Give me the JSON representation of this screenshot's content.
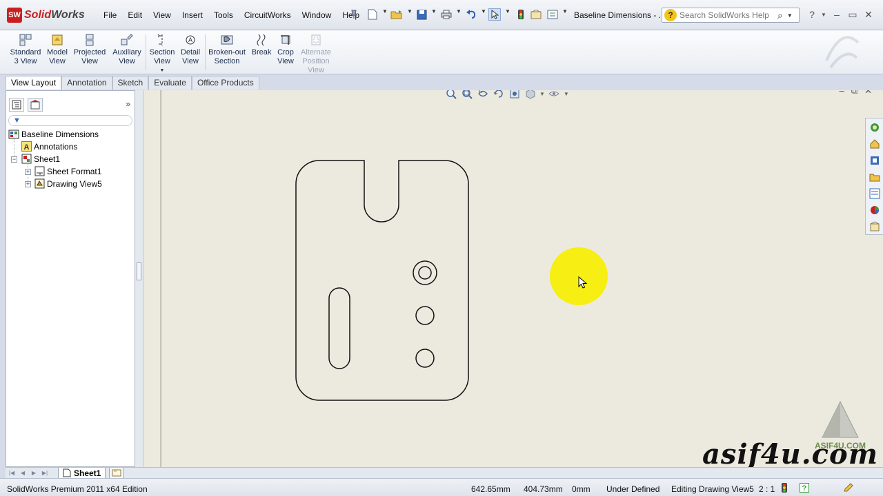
{
  "app": {
    "logo_badge": "SW",
    "logo_name_1": "Solid",
    "logo_name_2": "Works",
    "document_title": "Baseline Dimensions - ..."
  },
  "menu": [
    "File",
    "Edit",
    "View",
    "Insert",
    "Tools",
    "CircuitWorks",
    "Window",
    "Help"
  ],
  "help_search": {
    "placeholder": "Search SolidWorks Help"
  },
  "ribbon": {
    "standard_3_view": [
      "Standard",
      "3 View"
    ],
    "model_view": [
      "Model",
      "View"
    ],
    "projected_view": [
      "Projected",
      "View"
    ],
    "auxiliary_view": [
      "Auxiliary",
      "View"
    ],
    "section_view": [
      "Section",
      "View"
    ],
    "detail_view": [
      "Detail",
      "View"
    ],
    "broken_out_section": [
      "Broken-out",
      "Section"
    ],
    "break": [
      "Break"
    ],
    "crop_view": [
      "Crop",
      "View"
    ],
    "alternate_position_view": [
      "Alternate",
      "Position",
      "View"
    ]
  },
  "tabs": [
    "View Layout",
    "Annotation",
    "Sketch",
    "Evaluate",
    "Office Products"
  ],
  "active_tab": "View Layout",
  "feature_tree": {
    "root": "Baseline Dimensions",
    "annotations": "Annotations",
    "sheet": "Sheet1",
    "sheet_format": "Sheet Format1",
    "drawing_view": "Drawing View5"
  },
  "sheet_tabs": {
    "active": "Sheet1"
  },
  "watermark": {
    "logo_text": "ASIF4U.COM",
    "url": "asif4u.com"
  },
  "status": {
    "edition": "SolidWorks Premium 2011 x64 Edition",
    "x": "642.65mm",
    "y": "404.73mm",
    "z": "0mm",
    "state": "Under Defined",
    "editing": "Editing Drawing View5",
    "scale": "2 : 1"
  },
  "colors": {
    "brand_red": "#c8201e",
    "canvas_bg": "#eceadf",
    "cursor_highlight": "#f7ee13"
  }
}
